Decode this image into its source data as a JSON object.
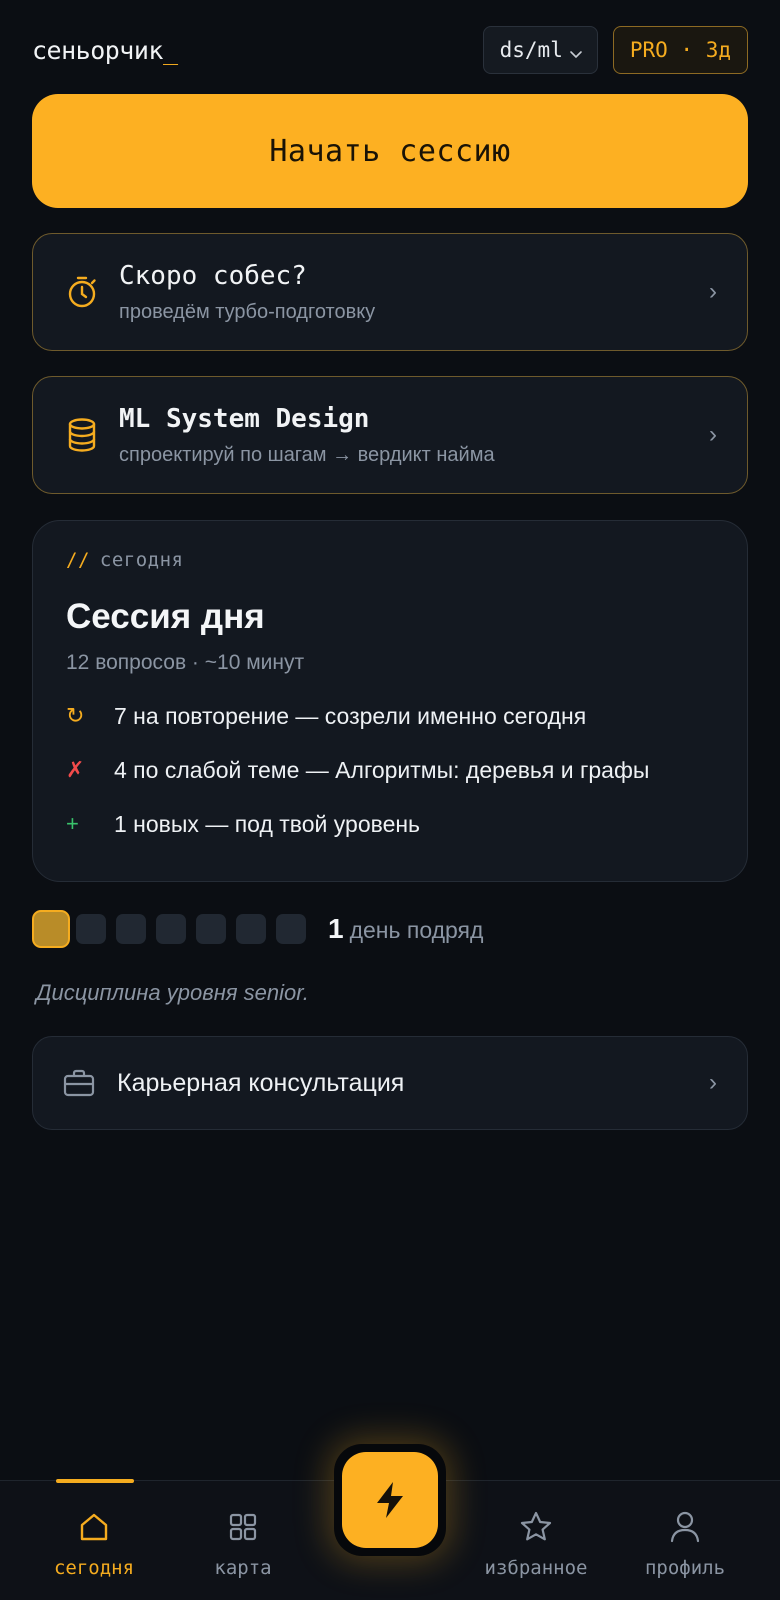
{
  "header": {
    "logo": "сеньорчик",
    "logo_cursor": "_",
    "track": "ds/ml",
    "pro_badge": "PRO · 3д"
  },
  "start_button": "Начать сессию",
  "promos": [
    {
      "title": "Скоро собес?",
      "subtitle": "проведём турбо-подготовку",
      "icon": "timer-icon"
    },
    {
      "title": "ML System Design",
      "subtitle": "спроектируй по шагам → вердикт найма",
      "icon": "database-icon"
    }
  ],
  "session": {
    "label_prefix": "//",
    "label": "сегодня",
    "title": "Сессия дня",
    "meta": "12 вопросов · ~10 минут",
    "rows": [
      {
        "mark": "↻",
        "text": "7 на повторение — созрели именно сегодня"
      },
      {
        "mark": "✗",
        "text": "4 по слабой теме — Алгоритмы: деревья и графы"
      },
      {
        "mark": "+",
        "text": "1 новых — под твой уровень"
      }
    ]
  },
  "streak": {
    "days_total": 7,
    "days_done": 1,
    "count": "1",
    "label": "день подряд"
  },
  "motto": "Дисциплина уровня senior.",
  "career": {
    "label": "Карьерная консультация",
    "icon": "briefcase-icon"
  },
  "nav": {
    "items": [
      {
        "label": "сегодня",
        "icon": "home-icon",
        "active": true
      },
      {
        "label": "карта",
        "icon": "grid-icon"
      },
      {
        "label": "избранное",
        "icon": "star-icon"
      },
      {
        "label": "профиль",
        "icon": "user-icon"
      }
    ],
    "fab_icon": "lightning-icon"
  },
  "colors": {
    "background": "#0b0e13",
    "accent": "#fdb022",
    "weak": "#f24b4b",
    "new": "#39c26b",
    "muted": "#8b95a3"
  }
}
